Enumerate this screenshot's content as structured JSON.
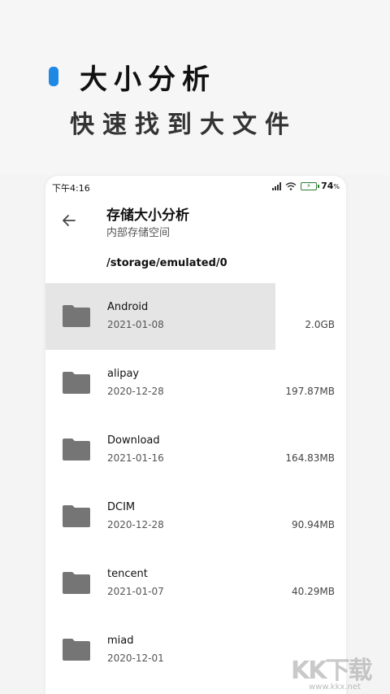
{
  "promo": {
    "title": "大小分析",
    "subtitle": "快速找到大文件"
  },
  "status_bar": {
    "time": "下午4:16",
    "battery_percent": "74",
    "battery_unit": "%"
  },
  "header": {
    "title": "存储大小分析",
    "subtitle": "内部存储空间"
  },
  "path": "/storage/emulated/0",
  "files": [
    {
      "name": "Android",
      "date": "2021-01-08",
      "size": "2.0GB",
      "selected": true
    },
    {
      "name": "alipay",
      "date": "2020-12-28",
      "size": "197.87MB",
      "selected": false
    },
    {
      "name": "Download",
      "date": "2021-01-16",
      "size": "164.83MB",
      "selected": false
    },
    {
      "name": "DCIM",
      "date": "2020-12-28",
      "size": "90.94MB",
      "selected": false
    },
    {
      "name": "tencent",
      "date": "2021-01-07",
      "size": "40.29MB",
      "selected": false
    },
    {
      "name": "miad",
      "date": "2020-12-01",
      "size": "",
      "selected": false
    }
  ],
  "watermark": {
    "logo": "KK下载",
    "url": "www.kkx.net"
  },
  "colors": {
    "accent": "#1e88e5",
    "folder": "#757575",
    "selected_row": "#e5e5e5",
    "battery": "#2e7d32"
  },
  "icons": {
    "back": "arrow-left-icon",
    "folder": "folder-icon",
    "signal": "signal-icon",
    "wifi": "wifi-icon",
    "battery": "battery-charging-icon"
  }
}
